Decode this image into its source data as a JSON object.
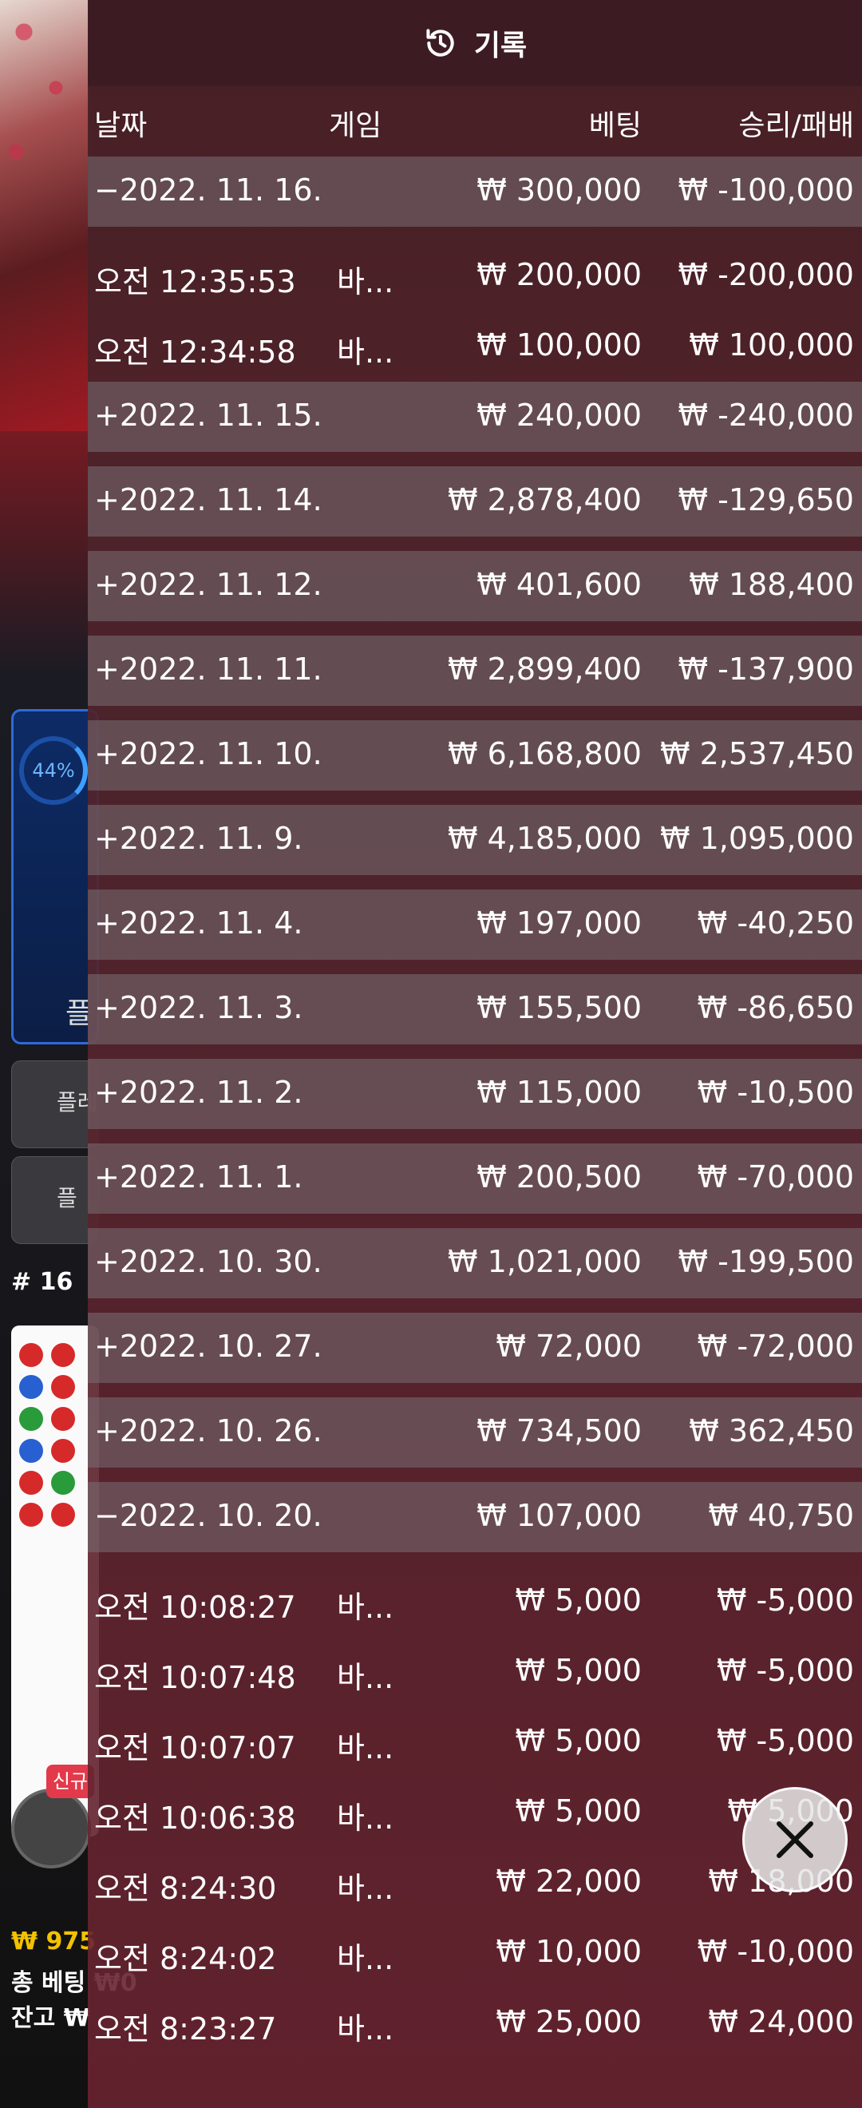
{
  "panel": {
    "title": "기록",
    "columns": {
      "date": "날짜",
      "game": "게임",
      "bet": "베팅",
      "result": "승리/패배"
    },
    "rows": [
      {
        "kind": "day",
        "date": "−2022. 11. 16.",
        "game": "",
        "bet": "₩ 300,000",
        "result": "₩ -100,000"
      },
      {
        "kind": "item",
        "date": "오전 12:35:53",
        "game": "바...",
        "bet": "₩ 200,000",
        "result": "₩ -200,000"
      },
      {
        "kind": "item",
        "date": "오전 12:34:58",
        "game": "바...",
        "bet": "₩ 100,000",
        "result": "₩ 100,000"
      },
      {
        "kind": "day",
        "date": "+2022. 11. 15.",
        "game": "",
        "bet": "₩ 240,000",
        "result": "₩ -240,000"
      },
      {
        "kind": "day",
        "date": "+2022. 11. 14.",
        "game": "",
        "bet": "₩ 2,878,400",
        "result": "₩ -129,650"
      },
      {
        "kind": "day",
        "date": "+2022. 11. 12.",
        "game": "",
        "bet": "₩ 401,600",
        "result": "₩ 188,400"
      },
      {
        "kind": "day",
        "date": "+2022. 11. 11.",
        "game": "",
        "bet": "₩ 2,899,400",
        "result": "₩ -137,900"
      },
      {
        "kind": "day",
        "date": "+2022. 11. 10.",
        "game": "",
        "bet": "₩ 6,168,800",
        "result": "₩ 2,537,450"
      },
      {
        "kind": "day",
        "date": "+2022. 11. 9.",
        "game": "",
        "bet": "₩ 4,185,000",
        "result": "₩ 1,095,000"
      },
      {
        "kind": "day",
        "date": "+2022. 11. 4.",
        "game": "",
        "bet": "₩ 197,000",
        "result": "₩ -40,250"
      },
      {
        "kind": "day",
        "date": "+2022. 11. 3.",
        "game": "",
        "bet": "₩ 155,500",
        "result": "₩ -86,650"
      },
      {
        "kind": "day",
        "date": "+2022. 11. 2.",
        "game": "",
        "bet": "₩ 115,000",
        "result": "₩ -10,500"
      },
      {
        "kind": "day",
        "date": "+2022. 11. 1.",
        "game": "",
        "bet": "₩ 200,500",
        "result": "₩ -70,000"
      },
      {
        "kind": "day",
        "date": "+2022. 10. 30.",
        "game": "",
        "bet": "₩ 1,021,000",
        "result": "₩ -199,500"
      },
      {
        "kind": "day",
        "date": "+2022. 10. 27.",
        "game": "",
        "bet": "₩ 72,000",
        "result": "₩ -72,000"
      },
      {
        "kind": "day",
        "date": "+2022. 10. 26.",
        "game": "",
        "bet": "₩ 734,500",
        "result": "₩ 362,450"
      },
      {
        "kind": "day",
        "date": "−2022. 10. 20.",
        "game": "",
        "bet": "₩ 107,000",
        "result": "₩ 40,750"
      },
      {
        "kind": "item",
        "date": "오전 10:08:27",
        "game": "바...",
        "bet": "₩ 5,000",
        "result": "₩ -5,000"
      },
      {
        "kind": "item",
        "date": "오전 10:07:48",
        "game": "바...",
        "bet": "₩ 5,000",
        "result": "₩ -5,000"
      },
      {
        "kind": "item",
        "date": "오전 10:07:07",
        "game": "바...",
        "bet": "₩ 5,000",
        "result": "₩ -5,000"
      },
      {
        "kind": "item",
        "date": "오전 10:06:38",
        "game": "바...",
        "bet": "₩ 5,000",
        "result": "₩ 5,000"
      },
      {
        "kind": "item",
        "date": "오전 8:24:30",
        "game": "바...",
        "bet": "₩ 22,000",
        "result": "₩ 18,000"
      },
      {
        "kind": "item",
        "date": "오전 8:24:02",
        "game": "바...",
        "bet": "₩ 10,000",
        "result": "₩ -10,000"
      },
      {
        "kind": "item",
        "date": "오전 8:23:27",
        "game": "바...",
        "bet": "₩ 25,000",
        "result": "₩ 24,000"
      }
    ]
  },
  "background": {
    "stat_percent": "44%",
    "stat_label": "플",
    "button1_label": "플레",
    "button2_label": "플",
    "round_label": "# 16",
    "new_badge": "신규",
    "balance_line1": "₩ 975",
    "balance_line2": "총 베팅 ₩0",
    "balance_line3": "잔고 ₩"
  },
  "colors": {
    "accent_blue": "#2e6bd8",
    "banker_red": "#d62a2a",
    "player_blue": "#2860d1",
    "tie_green": "#2a9b3a"
  },
  "icons": {
    "header": "history-icon",
    "close": "close-icon"
  }
}
